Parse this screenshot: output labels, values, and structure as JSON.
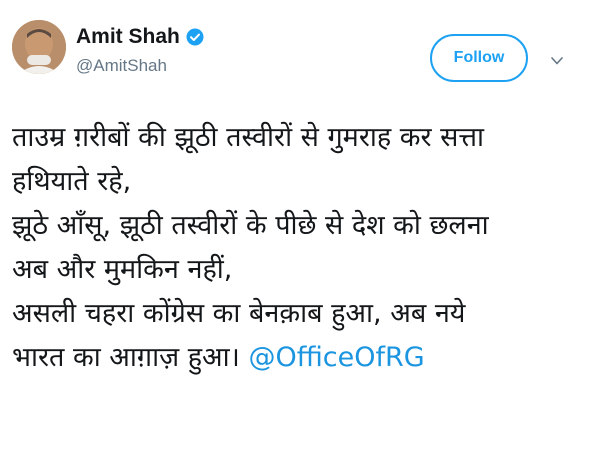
{
  "tweet": {
    "author": {
      "name": "Amit Shah",
      "handle": "@AmitShah",
      "verified": true
    },
    "follow_label": "Follow",
    "menu_icon": "chevron-down-icon",
    "lines": [
      "ताउम्र ग़रीबों की झूठी तस्वीरों से गुमराह कर सत्ता",
      "हथियाते रहे,",
      "झूठे आँसू, झूठी तस्वीरों के पीछे से देश को छलना",
      "अब और मुमकिन नहीं,",
      "असली चहरा कोंग्रेस का बेनक़ाब हुआ, अब नये"
    ],
    "last_line_text": "भारत का आग़ाज़ हुआ। ",
    "mention": "@OfficeOfRG"
  },
  "colors": {
    "accent": "#1da1f2",
    "mention": "#1b95e0",
    "text": "#14171a",
    "secondary": "#657786"
  }
}
